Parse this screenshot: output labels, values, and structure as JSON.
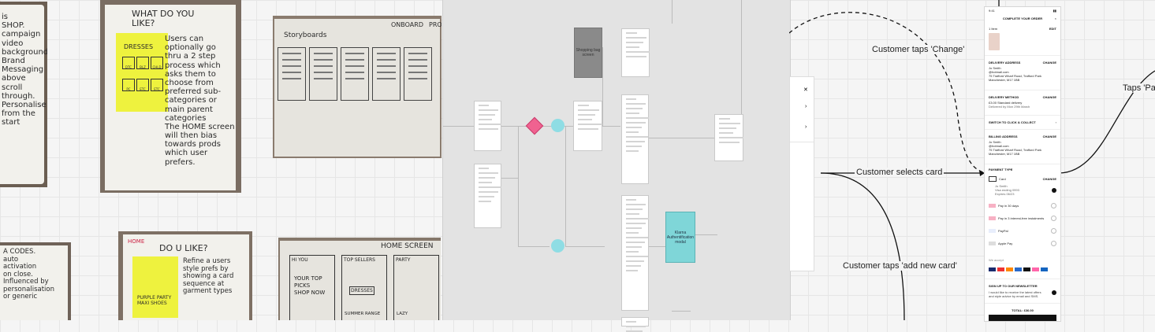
{
  "photo_left_top": {
    "lines": [
      "is",
      "SHOP.",
      "campaign",
      "video",
      "background.",
      "Brand",
      "Messaging",
      "above",
      "scroll",
      "through.",
      "Personalise",
      "from the",
      "start"
    ]
  },
  "photo_what": {
    "header": "WHAT DO YOU LIKE?",
    "sticky_title": "DRESSES",
    "sticky_cells": [
      "DTC",
      "BLZ",
      "CHLD",
      "PC",
      "ETC",
      "ETC"
    ],
    "body_lines": [
      "Users can",
      "optionally go",
      "thru a 2 step",
      "process which",
      "asks them to",
      "choose from",
      "preferred sub-",
      "categories or",
      "main parent",
      "categories",
      "The HOME screen",
      "will then bias",
      "towards prods",
      "which user",
      "prefers."
    ]
  },
  "photo_storyboard": {
    "title": "Storyboards",
    "tag": "ONBOARD",
    "tag2": "PRO"
  },
  "photo_codes": {
    "lines": [
      "A CODES.",
      "auto",
      "activation",
      "on close.",
      "Influenced by",
      "personalisation",
      "or generic"
    ]
  },
  "photo_doulike": {
    "tag": "HOME",
    "header": "DO U LIKE?",
    "body_lines": [
      "Refine a users",
      "style prefs by",
      "showing a card",
      "sequence at",
      "garment types"
    ],
    "sticky_lines": [
      "PURPLE PARTY",
      "MAXI SHOES"
    ]
  },
  "photo_home": {
    "title": "HOME SCREEN",
    "cells": [
      "HI YOU",
      "TOP SELLERS",
      "PARTY"
    ],
    "sub": [
      "YOUR TOP",
      "PICKS",
      "SHOP NOW"
    ],
    "dress": "DRESSES",
    "range": "SUMMER RANGE",
    "lazy": "LAZY"
  },
  "flow": {
    "shopping_bag": "Shopping bag screen",
    "klarna": "Klarna Authentification modal"
  },
  "connectors": {
    "change": "Customer taps 'Change'",
    "selects": "Customer selects card",
    "add_new": "Customer taps 'add new card'",
    "pay": "Taps 'Pay"
  },
  "phone": {
    "status_time": "9:41",
    "title": "COMPLETE YOUR ORDER",
    "close": "×",
    "items_label": "1 Item",
    "items_action": "EDIT",
    "delivery_address_h": "DELIVERY ADDRESS",
    "change": "CHANGE",
    "name": "Jo Smith",
    "email": "@hotmail.com",
    "address1": "75 Trafford Wharf Road, Trafford Park",
    "address2": "Manchester, M17 1BB",
    "delivery_method_h": "DELIVERY METHOD",
    "delivery_method": "£3.00 Standard delivery",
    "delivery_time": "Delivered by Mon 29th March",
    "switch": "SWITCH TO CLICK & COLLECT",
    "billing_h": "BILLING ADDRESS",
    "payment_h": "PAYMENT TYPE",
    "card": "Card",
    "card_name": "Jo Smith",
    "card_no": "Visa ending 0993",
    "card_exp": "Expires 06/23",
    "pay_options": [
      "Pay in 30 days",
      "Pay in 3 interest-free instalments",
      "PayPal",
      "Apple Pay"
    ],
    "we_accept": "We accept",
    "newsletter_h": "SIGN UP TO OUR NEWSLETTER",
    "newsletter_text": "I would like to receive the latest offers and style advice by email and SMS.",
    "total": "TOTAL: £36.00"
  },
  "colors": {
    "canvas": "#f5f5f5",
    "sticky": "#eef23e",
    "decision": "#f06290",
    "node": "#8fdde4",
    "klarna": "#7fd6d8",
    "bag": "#8a8a8a"
  }
}
